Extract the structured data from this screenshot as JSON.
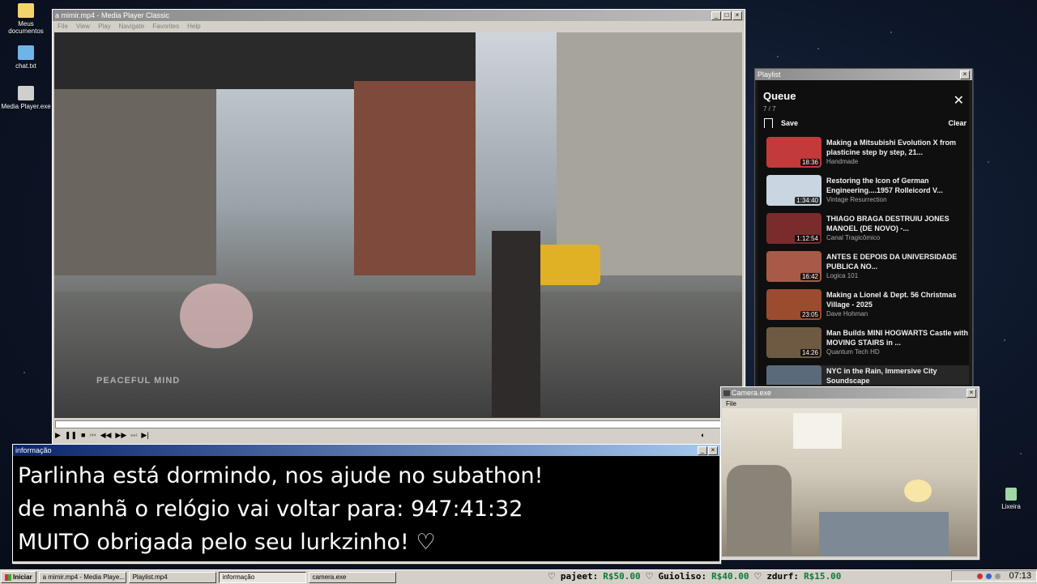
{
  "desktop": {
    "icons": [
      {
        "label": "Meus documentos",
        "icon": "folder-icon",
        "color": "#f3d36b"
      },
      {
        "label": "chat.txt",
        "icon": "notepad-icon",
        "color": "#6fb4e8"
      },
      {
        "label": "Media Player.exe",
        "icon": "media-player-icon",
        "color": "#cfcfcf"
      },
      {
        "label": "Lixeira",
        "icon": "recycle-bin-icon",
        "color": "#9fd7a7"
      }
    ]
  },
  "player": {
    "title": "a mimir.mp4 - Media Player Classic",
    "menu": [
      "File",
      "View",
      "Play",
      "Navigate",
      "Favorites",
      "Help"
    ],
    "watermark": "PEACEFUL MIND"
  },
  "playlist_window": {
    "title": "Playlist",
    "queue_title": "Queue",
    "count": "7 / 7",
    "save_label": "Save",
    "clear_label": "Clear",
    "items": [
      {
        "title": "Making a Mitsubishi Evolution X from plasticine step by step, 21...",
        "channel": "Handmade",
        "duration": "18:36",
        "color": "#c23a3a"
      },
      {
        "title": "Restoring the Icon of German Engineering....1957 Rolleicord V...",
        "channel": "Vintage Resurrection",
        "duration": "1:34:40",
        "color": "#c9d6e2"
      },
      {
        "title": "THIAGO BRAGA DESTRUIU JONES MANOEL (DE NOVO) -...",
        "channel": "Canal Tragicômico",
        "duration": "1:12:54",
        "color": "#7a2c2c"
      },
      {
        "title": "ANTES E DEPOIS DA UNIVERSIDADE PUBLICA NO...",
        "channel": "Logica 101",
        "duration": "16:42",
        "color": "#a85a48"
      },
      {
        "title": "Making a Lionel & Dept. 56 Christmas Village - 2025",
        "channel": "Dave Hohman",
        "duration": "23:05",
        "color": "#9b4b2e"
      },
      {
        "title": "Man Builds MINI HOGWARTS Castle with MOVING STAIRS in ...",
        "channel": "Quantum Tech HD",
        "duration": "14:26",
        "color": "#6e5a43"
      },
      {
        "title": "NYC in the Rain, Immersive City Soundscape",
        "channel": "",
        "duration": "",
        "color": "#5b6a7a"
      }
    ]
  },
  "info_window": {
    "title": "informação",
    "lines": [
      "Parlinha está dormindo, nos ajude no subathon!",
      "de manhã o relógio vai voltar para:  947:41:32",
      "MUITO obrigada pelo seu lurkzinho! ♡"
    ]
  },
  "camera_window": {
    "title": "Camera.exe",
    "menu": "File"
  },
  "taskbar": {
    "start_label": "Iniciar",
    "tasks": [
      "a mimir.mp4 - Media Playe...",
      "Playlist.mp4",
      "informação",
      "camera.exe"
    ],
    "ticker": [
      {
        "name": "pajeet:",
        "amount": "R$50.00"
      },
      {
        "name": "Guioliso:",
        "amount": "R$40.00"
      },
      {
        "name": "zdurf:",
        "amount": "R$15.00"
      }
    ],
    "clock": "07:13"
  }
}
